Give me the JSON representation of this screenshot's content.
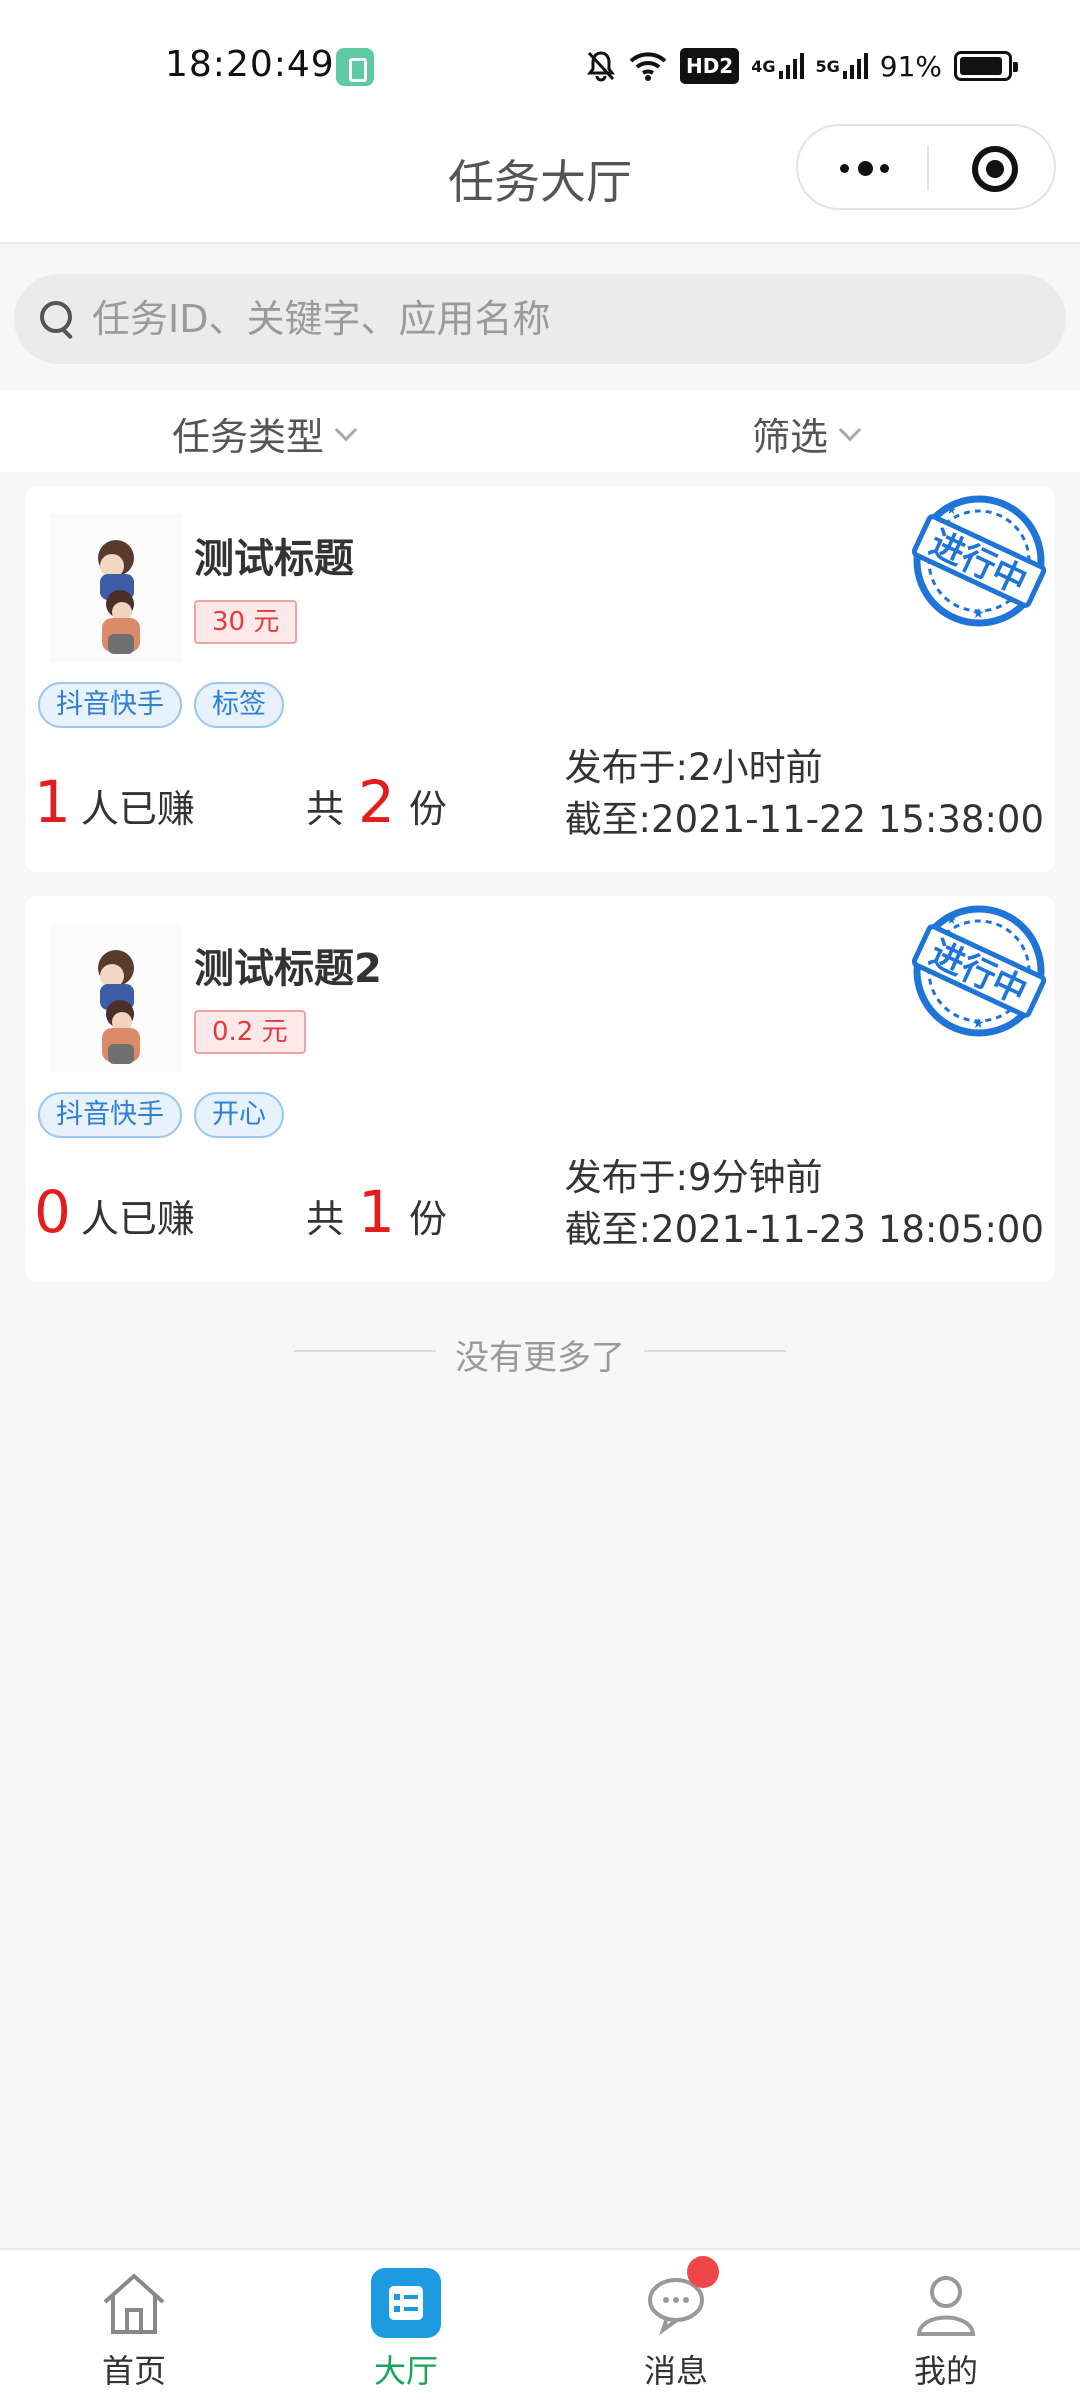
{
  "status_bar": {
    "time": "18:20:49",
    "network": "HD2",
    "signal_4g": "4G",
    "signal_5g": "5G",
    "battery_text": "91%",
    "battery_level": 0.91
  },
  "header": {
    "title": "任务大厅",
    "capsule_icons": [
      "more-dots-icon",
      "target-close-icon"
    ]
  },
  "search": {
    "placeholder": "任务ID、关键字、应用名称",
    "value": ""
  },
  "filters": {
    "task_type": "任务类型",
    "filter": "筛选"
  },
  "tasks": [
    {
      "title": "测试标题",
      "price": "30 元",
      "tags": [
        "抖音快手",
        "标签"
      ],
      "earned_count": "1",
      "earned_label": "人已赚",
      "total_prefix": "共",
      "total_count": "2",
      "total_suffix": "份",
      "published": "发布于:2小时前",
      "deadline": "截至:2021-11-22 15:38:00",
      "status_stamp": "进行中"
    },
    {
      "title": "测试标题2",
      "price": "0.2 元",
      "tags": [
        "抖音快手",
        "开心"
      ],
      "earned_count": "0",
      "earned_label": "人已赚",
      "total_prefix": "共",
      "total_count": "1",
      "total_suffix": "份",
      "published": "发布于:9分钟前",
      "deadline": "截至:2021-11-23 18:05:00",
      "status_stamp": "进行中"
    }
  ],
  "list_end": "没有更多了",
  "tabbar": {
    "items": [
      {
        "label": "首页",
        "icon": "home-icon",
        "active": false
      },
      {
        "label": "大厅",
        "icon": "task-list-icon",
        "active": true
      },
      {
        "label": "消息",
        "icon": "chat-bubble-icon",
        "active": false,
        "badge": true
      },
      {
        "label": "我的",
        "icon": "user-icon",
        "active": false
      }
    ]
  },
  "colors": {
    "accent_green": "#19a35a",
    "active_tab_bg": "#1d9be0",
    "number_red": "#e21d1d",
    "tag_blue": "#2f7fd3",
    "stamp_blue": "#1f74d8"
  }
}
